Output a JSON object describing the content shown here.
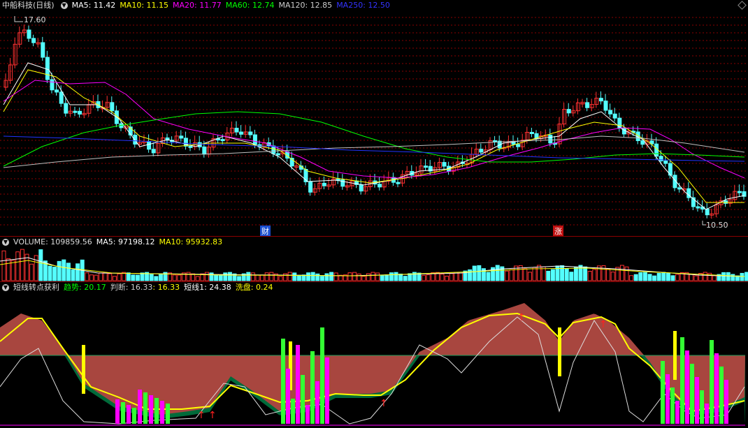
{
  "main": {
    "stock_title": "中船科技(日线)",
    "ma": [
      {
        "label": "MA5: 11.42",
        "color": "#ffffff"
      },
      {
        "label": "MA10: 11.15",
        "color": "#ffff00"
      },
      {
        "label": "MA20: 11.77",
        "color": "#ff00ff"
      },
      {
        "label": "MA60: 12.74",
        "color": "#00ff00"
      },
      {
        "label": "MA120: 12.85",
        "color": "#c0c0c0"
      },
      {
        "label": "MA250: 12.50",
        "color": "#0000ff"
      }
    ],
    "high_label": "17.60",
    "low_label": "10.50",
    "marker_cai": "财",
    "marker_zhang": "涨"
  },
  "volume": {
    "label": "VOLUME: 109859.56",
    "ma5": "MA5: 97198.12",
    "ma10": "MA10: 95932.83"
  },
  "indicator": {
    "name": "短线转点获利",
    "trend": "趋势: 20.17",
    "judge": "判断: 16.33",
    "judge2": ": 16.33",
    "short": "短线1: 24.38",
    "wash": "洗盘: 0.24"
  },
  "colors": {
    "up": "#ff3232",
    "down": "#54ffff",
    "grid": "#8b0000"
  }
}
